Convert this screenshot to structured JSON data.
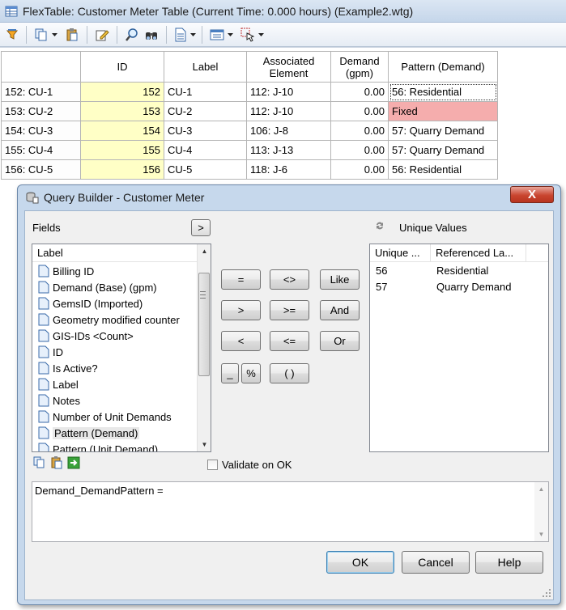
{
  "window": {
    "title": "FlexTable: Customer Meter Table (Current Time:  0.000 hours) (Example2.wtg)"
  },
  "toolbar": {
    "icons": [
      "filter-icon",
      "copy-icon",
      "paste-icon",
      "edit-icon",
      "zoom-icon",
      "find-icon",
      "report-icon",
      "table-options-icon",
      "select-icon"
    ]
  },
  "grid": {
    "headers": {
      "id": "ID",
      "label": "Label",
      "assoc_line1": "Associated",
      "assoc_line2": "Element",
      "demand_line1": "Demand",
      "demand_line2": "(gpm)",
      "pattern": "Pattern (Demand)"
    },
    "rows": [
      {
        "rowhdr": "152: CU-1",
        "id": "152",
        "label": "CU-1",
        "assoc": "112: J-10",
        "demand": "0.00",
        "pattern": "56: Residential"
      },
      {
        "rowhdr": "153: CU-2",
        "id": "153",
        "label": "CU-2",
        "assoc": "112: J-10",
        "demand": "0.00",
        "pattern": "Fixed"
      },
      {
        "rowhdr": "154: CU-3",
        "id": "154",
        "label": "CU-3",
        "assoc": "106: J-8",
        "demand": "0.00",
        "pattern": "57: Quarry Demand"
      },
      {
        "rowhdr": "155: CU-4",
        "id": "155",
        "label": "CU-4",
        "assoc": "113: J-13",
        "demand": "0.00",
        "pattern": "57: Quarry Demand"
      },
      {
        "rowhdr": "156: CU-5",
        "id": "156",
        "label": "CU-5",
        "assoc": "118: J-6",
        "demand": "0.00",
        "pattern": "56: Residential"
      }
    ]
  },
  "dialog": {
    "title": "Query Builder - Customer Meter",
    "close_label": "X",
    "fields_label": "Fields",
    "expand_label": ">",
    "field_list": {
      "header": "Label",
      "items": [
        "Billing ID",
        "Demand (Base) (gpm)",
        "GemsID (Imported)",
        "Geometry modified counter",
        "GIS-IDs <Count>",
        "ID",
        "Is Active?",
        "Label",
        "Notes",
        "Number of Unit Demands",
        "Pattern (Demand)",
        "Pattern (Unit Demand)"
      ],
      "selected": "Pattern (Demand)"
    },
    "operators": {
      "eq": "=",
      "ne": "<>",
      "like": "Like",
      "gt": ">",
      "ge": ">=",
      "and": "And",
      "lt": "<",
      "le": "<=",
      "or": "Or",
      "underscore": "_",
      "percent": "%",
      "parens": "( )"
    },
    "unique_values_label": "Unique Values",
    "unique_values": {
      "headers": [
        "Unique ...",
        "Referenced La..."
      ],
      "rows": [
        [
          "56",
          "Residential"
        ],
        [
          "57",
          "Quarry Demand"
        ]
      ]
    },
    "validate_label": "Validate on OK",
    "validate_checked": false,
    "expression": "Demand_DemandPattern =",
    "buttons": {
      "ok": "OK",
      "cancel": "Cancel",
      "help": "Help"
    }
  },
  "colors": {
    "id_cell": "#ffffc6",
    "fixed_cell": "#f5adad",
    "dialog_frame": "#c6d8ec",
    "close_button": "#c9452f"
  }
}
